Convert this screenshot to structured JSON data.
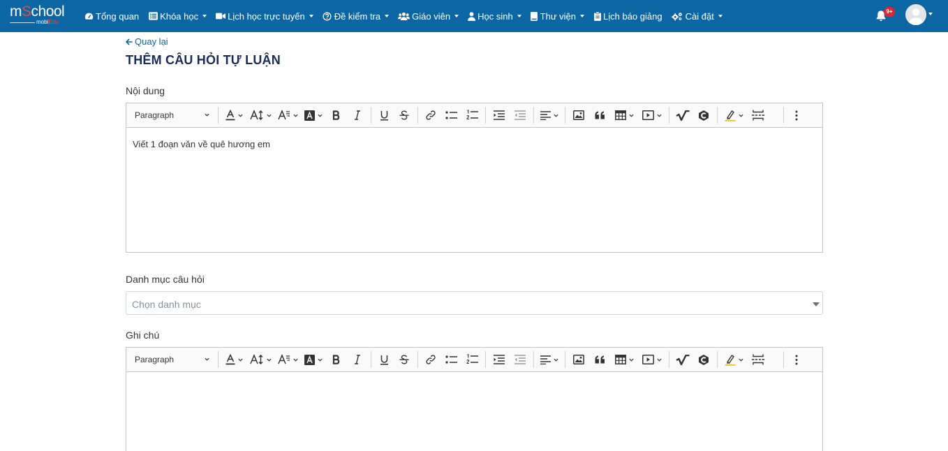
{
  "logo": {
    "brand_left": "m",
    "brand_mid": "S",
    "brand_right": "chool",
    "sub_left": "mobi",
    "sub_mid": "Edu"
  },
  "nav": {
    "items": [
      {
        "label": "Tổng quan",
        "icon": "dashboard-icon",
        "has_caret": false
      },
      {
        "label": "Khóa học",
        "icon": "list-icon",
        "has_caret": true
      },
      {
        "label": "Lịch học trực tuyến",
        "icon": "video-icon",
        "has_caret": true
      },
      {
        "label": "Đề kiểm tra",
        "icon": "question-circle-icon",
        "has_caret": true
      },
      {
        "label": "Giáo viên",
        "icon": "users-icon",
        "has_caret": true
      },
      {
        "label": "Học sinh",
        "icon": "user-icon",
        "has_caret": true
      },
      {
        "label": "Thư viện",
        "icon": "book-icon",
        "has_caret": true
      },
      {
        "label": "Lịch báo giảng",
        "icon": "clipboard-icon",
        "has_caret": false
      },
      {
        "label": "Cài đặt",
        "icon": "gears-icon",
        "has_caret": true
      }
    ],
    "notification_badge": "9+"
  },
  "page": {
    "back_label": "Quay lại",
    "title": "THÊM CÂU HỎI TỰ LUẬN"
  },
  "content_field": {
    "label": "Nội dung",
    "heading_select": "Paragraph",
    "text": "Viết 1 đoạn văn về quê hương em"
  },
  "category_field": {
    "label": "Danh mục câu hỏi",
    "placeholder": "Chọn danh mục"
  },
  "note_field": {
    "label": "Ghi chú",
    "heading_select": "Paragraph",
    "text": ""
  },
  "colors": {
    "navbar": "#0d66a4",
    "title": "#1a2b56",
    "link": "#0d66a4",
    "badge": "#e3242b"
  }
}
